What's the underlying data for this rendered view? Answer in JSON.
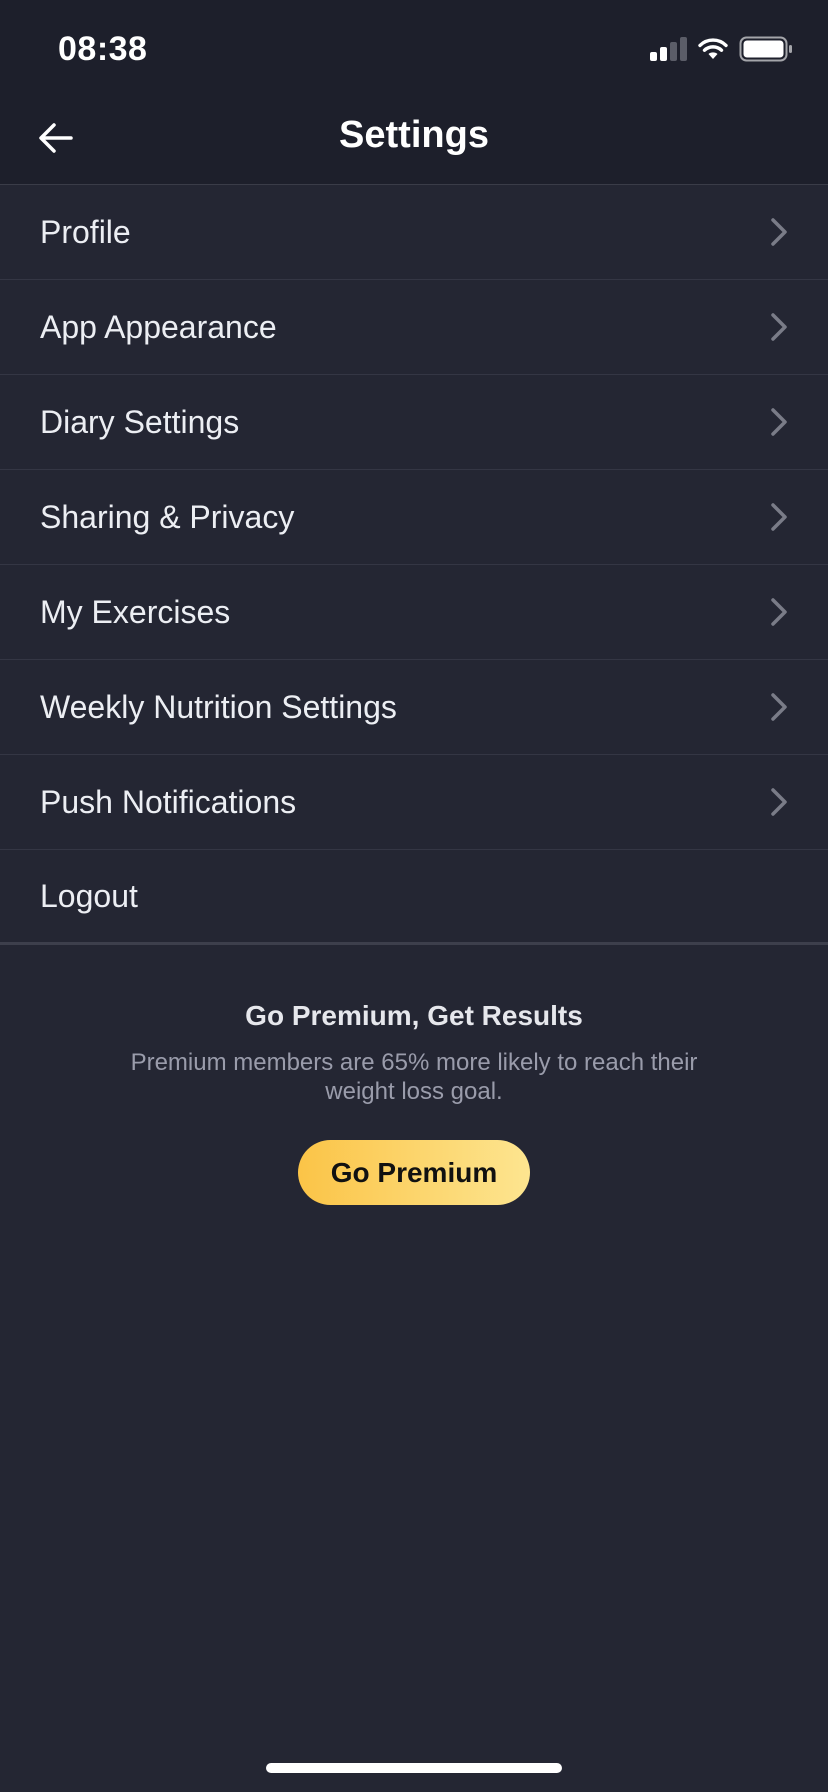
{
  "status_bar": {
    "time": "08:38",
    "signal_icon": "cellular-signal-icon",
    "wifi_icon": "wifi-icon",
    "battery_icon": "battery-icon"
  },
  "header": {
    "title": "Settings",
    "back_icon": "arrow-left-icon"
  },
  "menu": {
    "items": [
      {
        "label": "Profile",
        "chevron": true
      },
      {
        "label": "App Appearance",
        "chevron": true
      },
      {
        "label": "Diary Settings",
        "chevron": true
      },
      {
        "label": "Sharing & Privacy",
        "chevron": true
      },
      {
        "label": "My Exercises",
        "chevron": true
      },
      {
        "label": "Weekly Nutrition Settings",
        "chevron": true
      },
      {
        "label": "Push Notifications",
        "chevron": true
      },
      {
        "label": "Logout",
        "chevron": false
      }
    ]
  },
  "premium": {
    "title": "Go Premium, Get Results",
    "subtitle": "Premium members are 65% more likely to reach their weight loss goal.",
    "button_label": "Go Premium"
  },
  "colors": {
    "background": "#242633",
    "header_background": "#1d1f2b",
    "accent_start": "#fbc447",
    "accent_end": "#fde590"
  }
}
